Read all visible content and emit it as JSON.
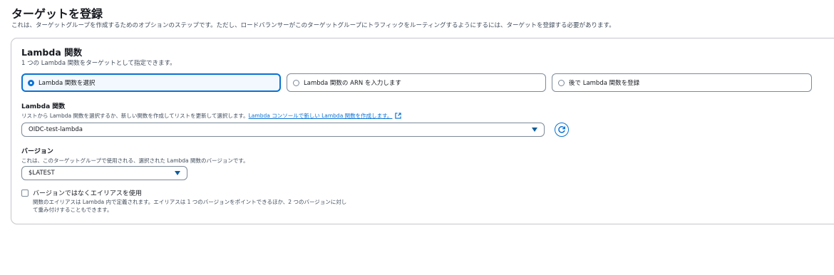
{
  "page": {
    "title": "ターゲットを登録",
    "description": "これは、ターゲットグループを作成するためのオプションのステップです。ただし、ロードバランサーがこのターゲットグループにトラフィックをルーティングするようにするには、ターゲットを登録する必要があります。"
  },
  "lambda_section": {
    "title": "Lambda 関数",
    "description": "1 つの Lambda 関数をターゲットとして指定できます。",
    "options": [
      {
        "label": "Lambda 関数を選択",
        "selected": true
      },
      {
        "label": "Lambda 関数の ARN を入力します",
        "selected": false
      },
      {
        "label": "後で Lambda 関数を登録",
        "selected": false
      }
    ]
  },
  "function_field": {
    "label": "Lambda 関数",
    "description": "リストから Lambda 関数を選択するか、新しい関数を作成してリストを更新して選択します。",
    "link_text": "Lambda コンソールで新しい Lambda 関数を作成します。",
    "value": "OIDC-test-lambda"
  },
  "version_field": {
    "label": "バージョン",
    "description": "これは、このターゲットグループで使用される、選択された Lambda 関数のバージョンです。",
    "value": "$LATEST"
  },
  "alias_option": {
    "label": "バージョンではなくエイリアスを使用",
    "description_line1": "関数のエイリアスは Lambda 内で定義されます。エイリアスは 1 つのバージョンをポイントできるほか、2 つのバージョンに対し",
    "description_line2": "て重み付けすることもできます。",
    "checked": false
  },
  "colors": {
    "accent": "#0972d3",
    "border": "#7d8998",
    "muted_text": "#414d5c"
  }
}
